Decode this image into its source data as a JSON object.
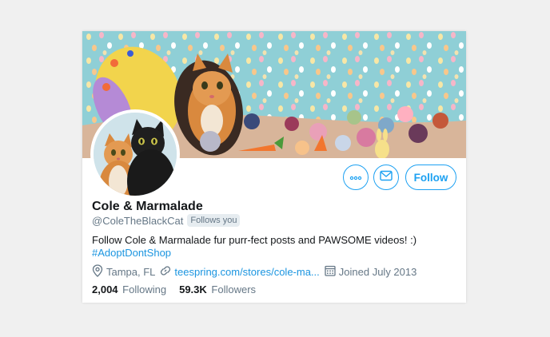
{
  "profile": {
    "name": "Cole & Marmalade",
    "handle": "@ColeTheBlackCat",
    "follows_you": "Follows you",
    "bio_text": "Follow Cole & Marmalade fur purr-fect posts and PAWSOME videos! :)",
    "bio_hashtag": "#AdoptDontShop",
    "location": "Tampa, FL",
    "website": "teespring.com/stores/cole-ma...",
    "joined": "Joined July 2013"
  },
  "stats": {
    "following_count": "2,004",
    "following_label": "Following",
    "followers_count": "59.3K",
    "followers_label": "Followers"
  },
  "actions": {
    "follow_label": "Follow"
  },
  "icons": {
    "more": "more-dots-icon",
    "message": "envelope-icon",
    "location": "location-pin-icon",
    "link": "link-icon",
    "calendar": "calendar-icon"
  },
  "colors": {
    "accent": "#1da1f2",
    "link": "#1b95e0",
    "secondary_text": "#657786",
    "primary_text": "#14171a"
  }
}
